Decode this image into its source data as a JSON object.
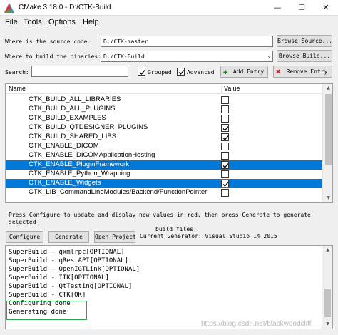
{
  "window": {
    "title": "CMake 3.18.0 - D:/CTK-Build",
    "controls": {
      "minimize": "—",
      "maximize": "☐",
      "close": "✕"
    }
  },
  "menu": [
    "File",
    "Tools",
    "Options",
    "Help"
  ],
  "source": {
    "label": "Where is the source code:",
    "value": "D:/CTK-master",
    "button": "Browse Source..."
  },
  "build": {
    "label": "Where to build the binaries:",
    "value": "D:/CTK-Build",
    "button": "Browse Build..."
  },
  "search": {
    "label": "Search:",
    "value": "",
    "grouped": {
      "label": "Grouped",
      "checked": true
    },
    "advanced": {
      "label": "Advanced",
      "checked": true
    },
    "add_entry": "Add Entry",
    "remove_entry": "Remove Entry"
  },
  "table": {
    "columns": [
      "Name",
      "Value"
    ],
    "rows": [
      {
        "name": "CTK_BUILD_ALL_LIBRARIES",
        "checked": false,
        "selected": false
      },
      {
        "name": "CTK_BUILD_ALL_PLUGINS",
        "checked": false,
        "selected": false
      },
      {
        "name": "CTK_BUILD_EXAMPLES",
        "checked": false,
        "selected": false
      },
      {
        "name": "CTK_BUILD_QTDESIGNER_PLUGINS",
        "checked": true,
        "selected": false
      },
      {
        "name": "CTK_BUILD_SHARED_LIBS",
        "checked": true,
        "selected": false
      },
      {
        "name": "CTK_ENABLE_DICOM",
        "checked": false,
        "selected": false
      },
      {
        "name": "CTK_ENABLE_DICOMApplicationHosting",
        "checked": false,
        "selected": false
      },
      {
        "name": "CTK_ENABLE_PluginFramework",
        "checked": true,
        "selected": true
      },
      {
        "name": "CTK_ENABLE_Python_Wrapping",
        "checked": false,
        "selected": false
      },
      {
        "name": "CTK_ENABLE_Widgets",
        "checked": true,
        "selected": true
      },
      {
        "name": "CTK_LIB_CommandLineModules/Backend/FunctionPointer",
        "checked": false,
        "selected": false
      }
    ]
  },
  "status_message": {
    "line1": "Press Configure to update and display new values in red, then press Generate to generate selected",
    "line2": "build files."
  },
  "actions": {
    "configure": "Configure",
    "generate": "Generate",
    "open_project": "Open Project",
    "current_generator": "Current Generator: Visual Studio 14 2015"
  },
  "output": {
    "lines": [
      "SuperBuild - qxmlrpc[OPTIONAL]",
      "SuperBuild - qRestAPI[OPTIONAL]",
      "SuperBuild - OpenIGTLink[OPTIONAL]",
      "SuperBuild - ITK[OPTIONAL]",
      "SuperBuild - QtTesting[OPTIONAL]",
      "SuperBuild - CTK[OK]",
      "Configuring done",
      "Generating done"
    ]
  },
  "watermark": "https://blog.csdn.net/blackwoodcliff"
}
